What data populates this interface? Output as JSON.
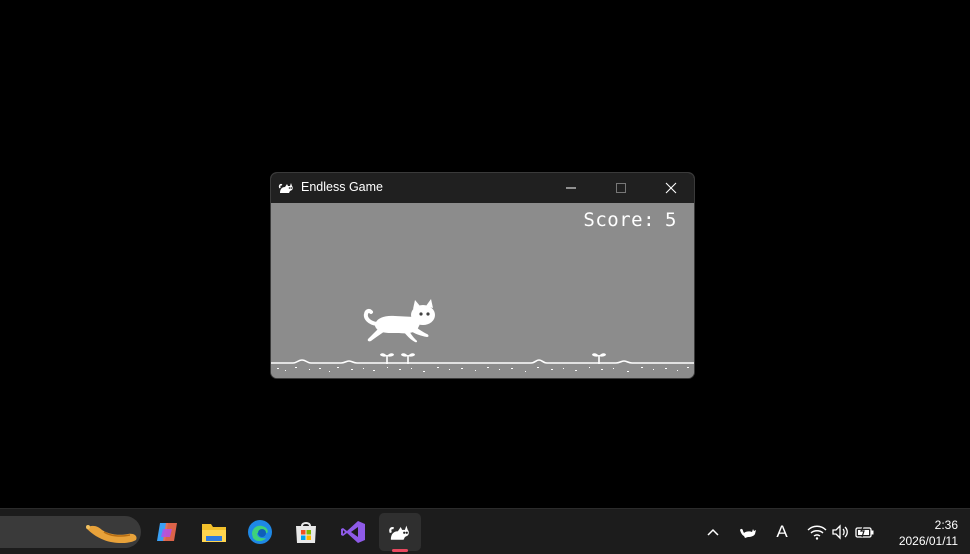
{
  "window": {
    "title": "Endless Game",
    "icon": "cat-icon"
  },
  "game": {
    "score_label": "Score:",
    "score_value": "5",
    "colors": {
      "background": "#8c8c8c",
      "sprite": "#ffffff"
    }
  },
  "taskbar": {
    "pinned": [
      {
        "name": "widgets",
        "icon": "widgets-weather-icon"
      },
      {
        "name": "copilot",
        "icon": "copilot-icon"
      },
      {
        "name": "file-explorer",
        "icon": "folder-icon"
      },
      {
        "name": "edge",
        "icon": "edge-browser-icon"
      },
      {
        "name": "microsoft-store",
        "icon": "store-icon"
      },
      {
        "name": "visual-studio",
        "icon": "visual-studio-icon"
      },
      {
        "name": "endless-game",
        "icon": "cat-icon",
        "active": true
      }
    ],
    "tray": {
      "icons": [
        "chevron-up-icon",
        "cat-tray-icon",
        "ime-a-icon",
        "wifi-icon",
        "volume-icon",
        "battery-icon"
      ],
      "ime_label": "A"
    },
    "clock": {
      "time": "2:36",
      "date": "2026/01/11"
    }
  }
}
